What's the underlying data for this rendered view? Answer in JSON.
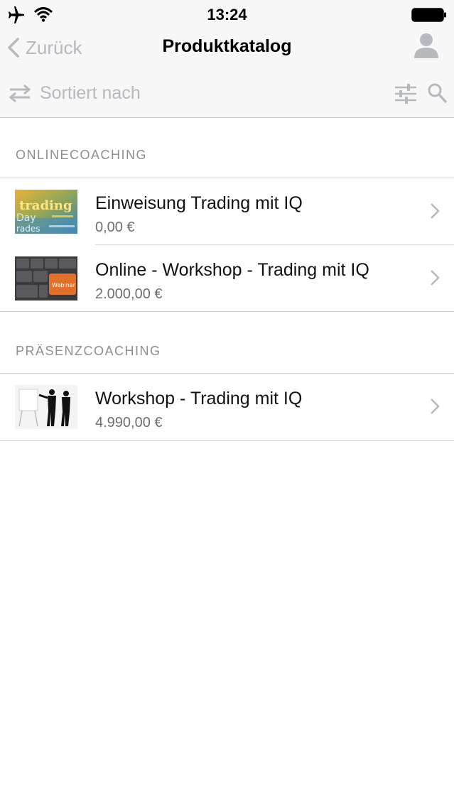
{
  "status_bar": {
    "time": "13:24",
    "icons": [
      "airplane-icon",
      "wifi-icon",
      "battery-icon"
    ]
  },
  "nav_bar": {
    "back_label": "Zurück",
    "title": "Produktkatalog",
    "right_icon": "person-icon"
  },
  "sort_bar": {
    "label": "Sortiert nach",
    "icons": [
      "sort-arrows-icon",
      "filter-sliders-icon",
      "search-icon"
    ]
  },
  "sections": [
    {
      "header": "ONLINECOACHING",
      "items": [
        {
          "title": "Einweisung Trading mit IQ",
          "price": "0,00 €",
          "thumb": "trading-word-cloud",
          "thumb_words": [
            "trading",
            "Day",
            "rades"
          ]
        },
        {
          "title": "Online - Workshop - Trading mit IQ",
          "price": "2.000,00 €",
          "thumb": "keyboard-webinar-key",
          "thumb_words": [
            "Webinar"
          ]
        }
      ]
    },
    {
      "header": "PRÄSENZCOACHING",
      "items": [
        {
          "title": "Workshop - Trading mit IQ",
          "price": "4.990,00 €",
          "thumb": "presentation-silhouettes"
        }
      ]
    }
  ],
  "colors": {
    "bar_bg": "#f7f7f8",
    "muted_gray": "#b6b9be",
    "section_gray": "#8e8e93",
    "price_gray": "#6e6e73"
  }
}
